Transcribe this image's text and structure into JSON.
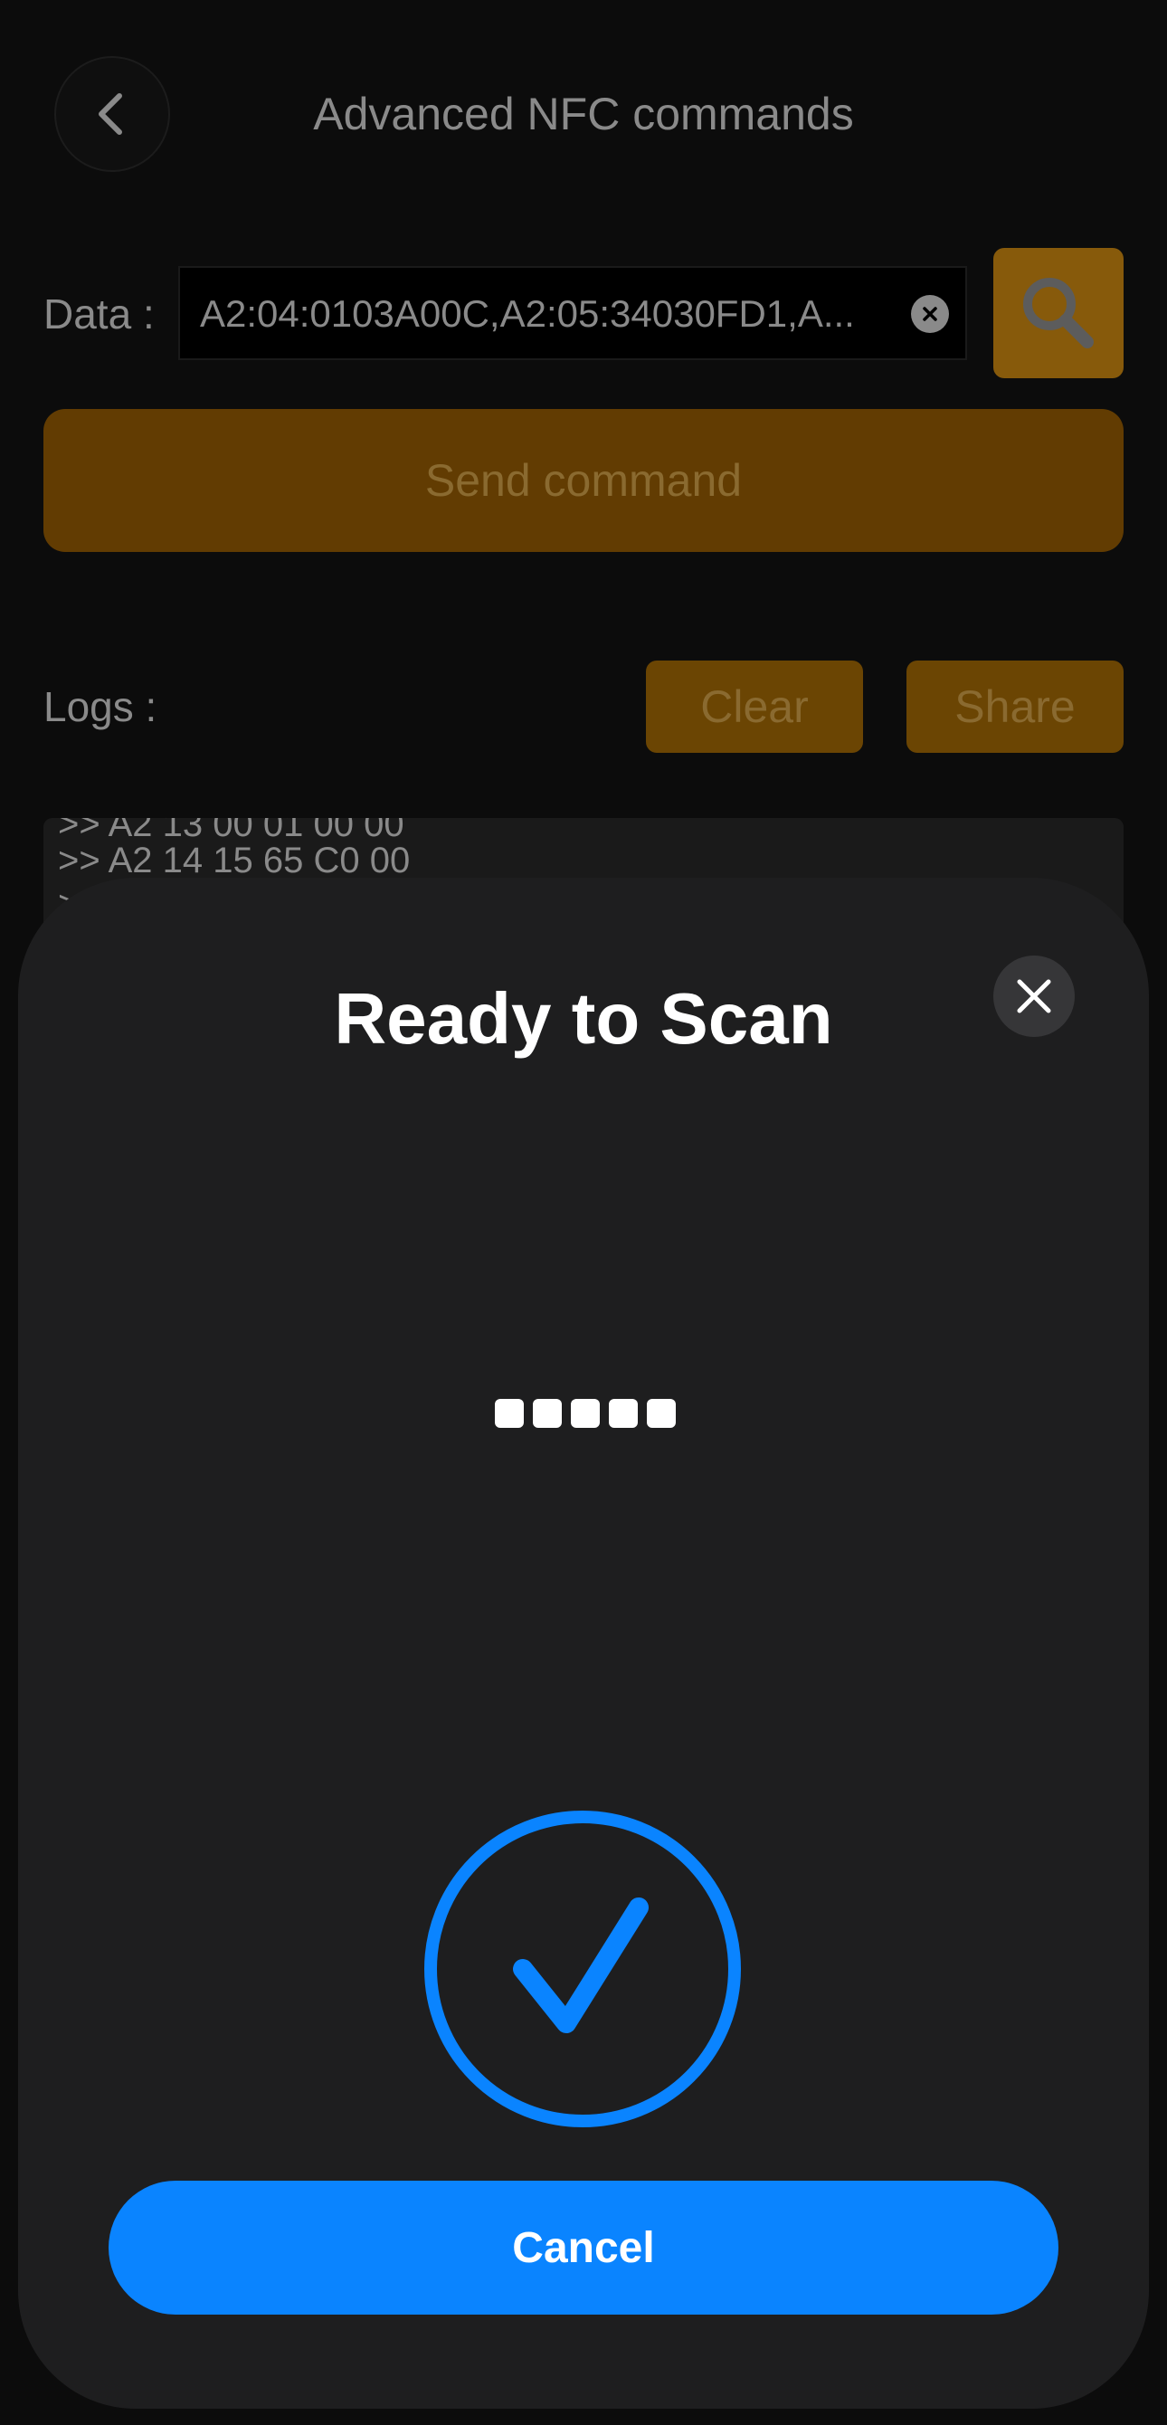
{
  "header": {
    "title": "Advanced NFC commands"
  },
  "form": {
    "data_label": "Data :",
    "data_value": "A2:04:0103A00C,A2:05:34030FD1,A...",
    "send_label": "Send command"
  },
  "logs": {
    "label": "Logs :",
    "clear_label": "Clear",
    "share_label": "Share",
    "lines": [
      ">> A2 13 00 01 00 00",
      ">> A2 14 15 65 C0 00",
      ">"
    ]
  },
  "sheet": {
    "title": "Ready to Scan",
    "cancel_label": "Cancel"
  },
  "colors": {
    "accent_orange": "#623c02",
    "ios_blue": "#0a84ff",
    "sheet_bg": "#1e1e1f"
  },
  "icons": {
    "back": "chevron-left-icon",
    "search": "search-icon",
    "clear_input": "close-circle-icon",
    "sheet_close": "close-icon",
    "success": "checkmark-circle-icon"
  }
}
